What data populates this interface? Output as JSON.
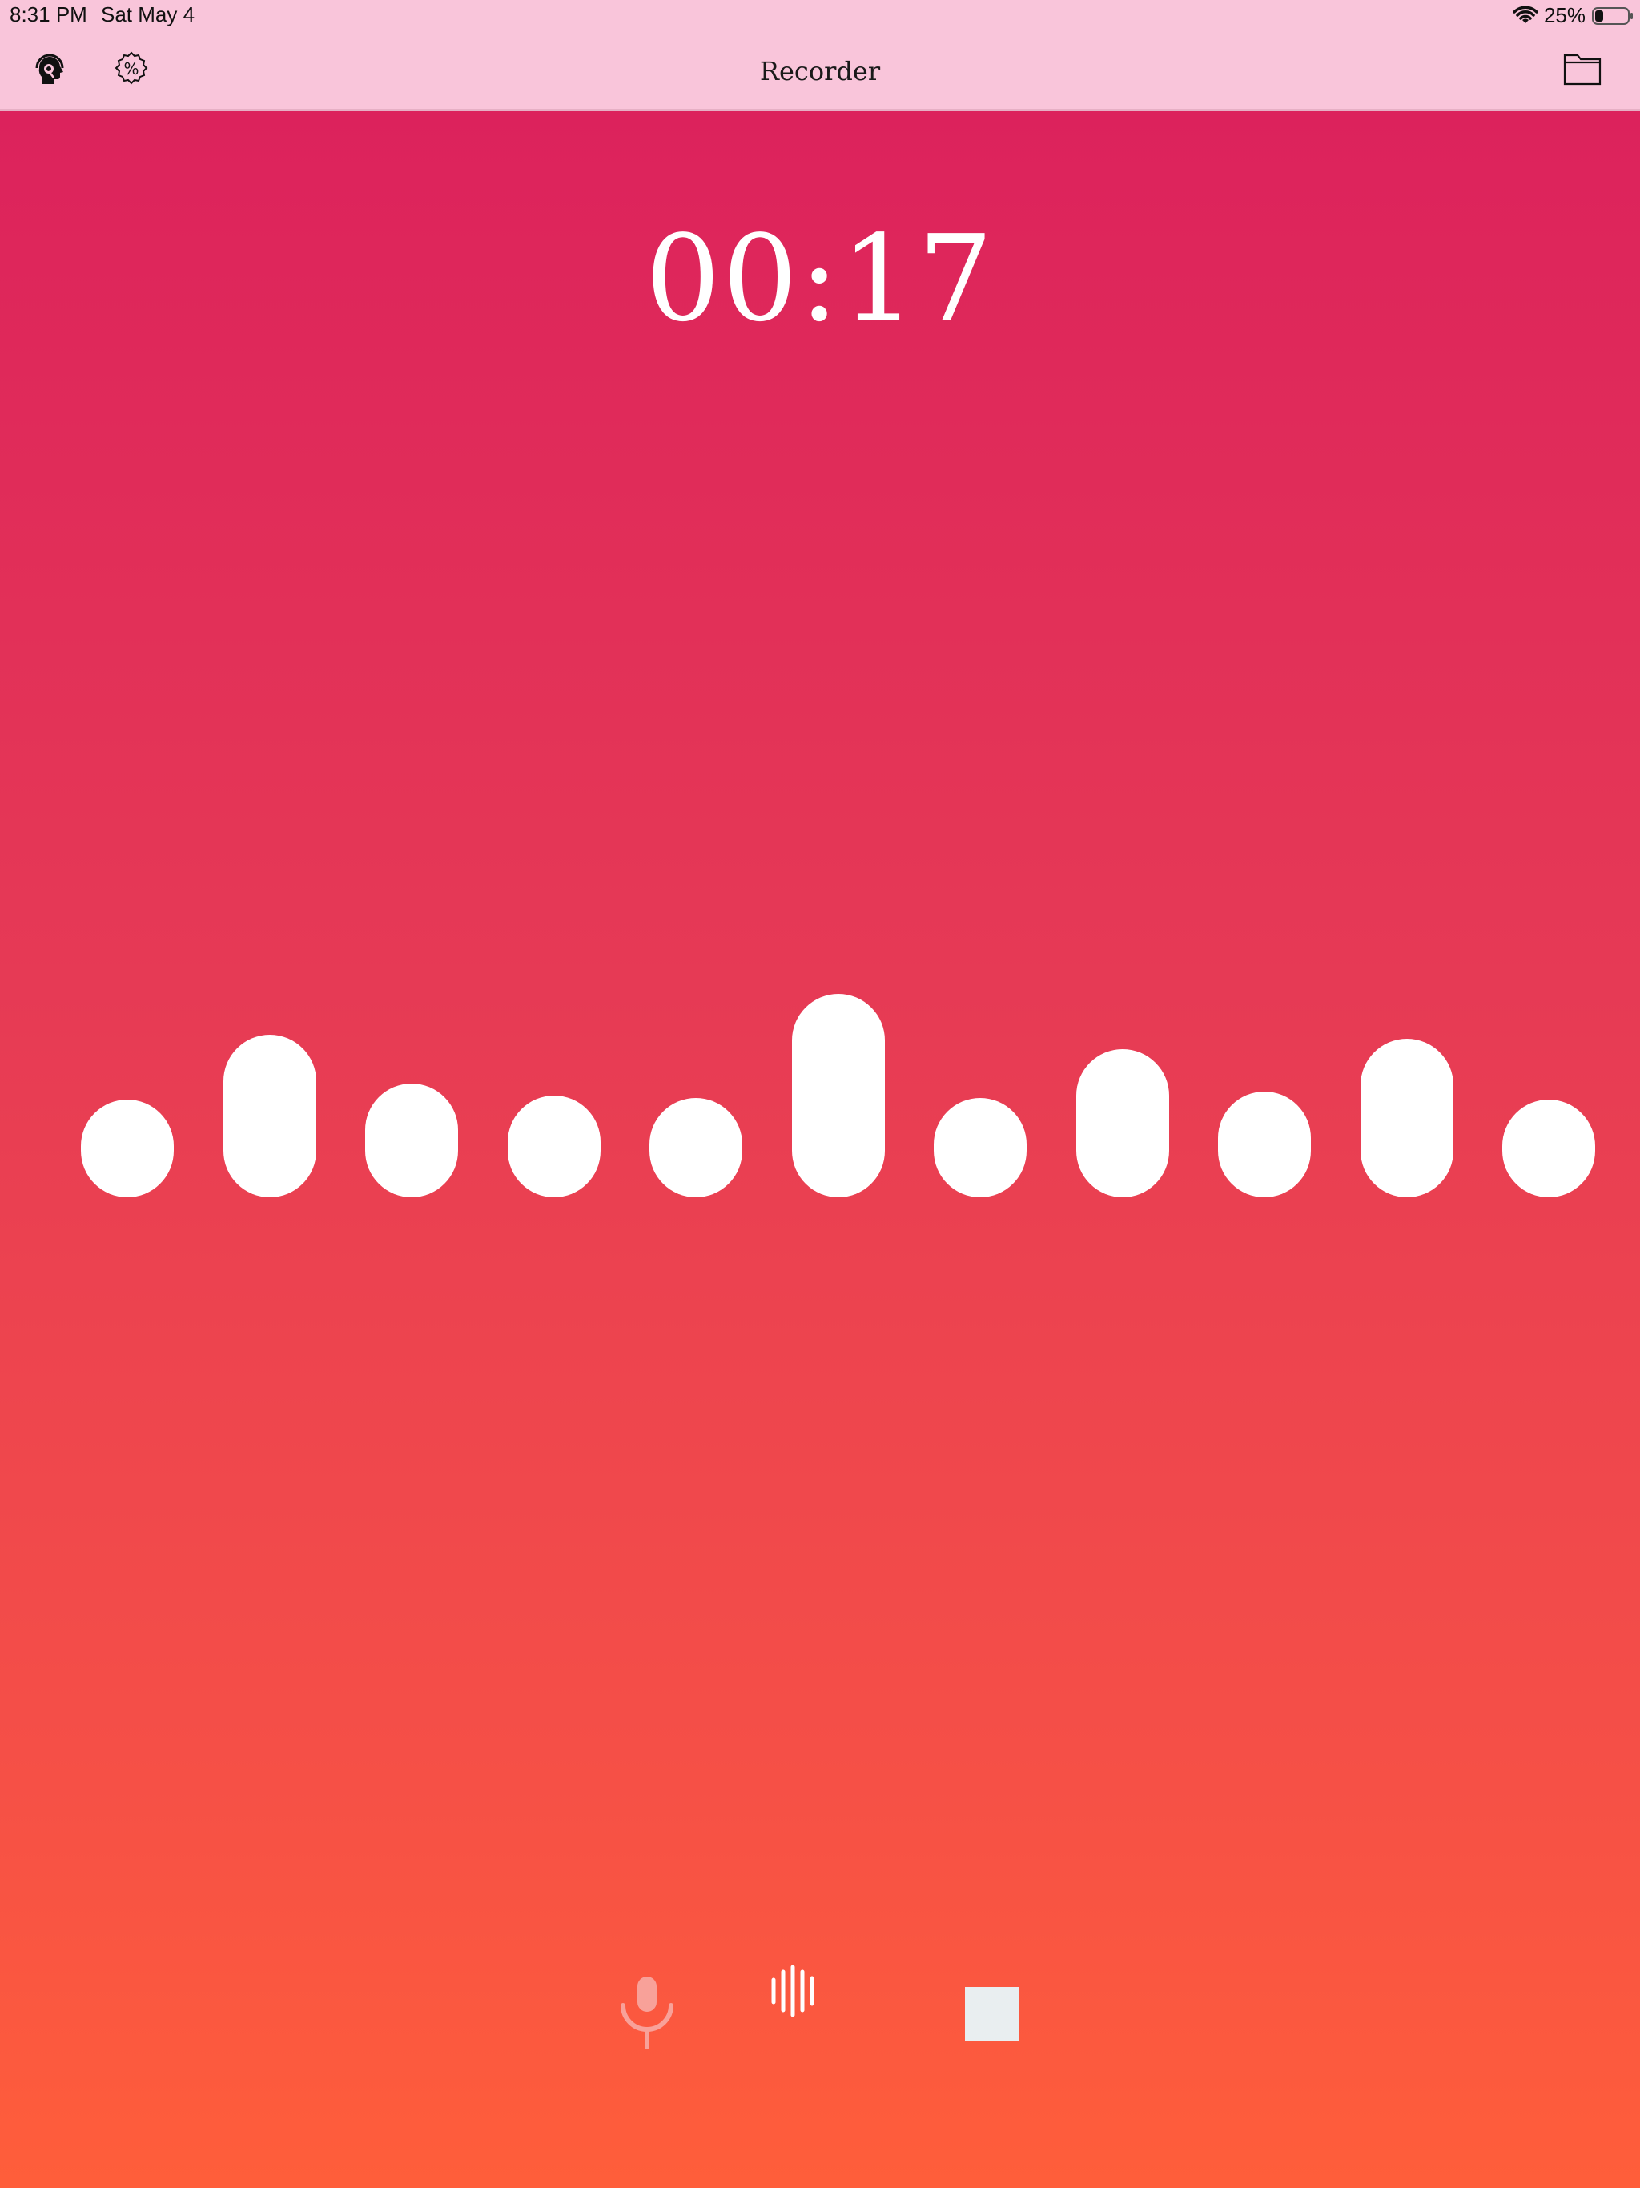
{
  "status_bar": {
    "time": "8:31 PM",
    "date": "Sat May 4",
    "battery_percent": "25%",
    "battery_level": 0.25
  },
  "nav": {
    "title": "Recorder",
    "left_icons": [
      "support-agent-icon",
      "settings-badge-icon"
    ],
    "right_icon": "folder-icon"
  },
  "recorder": {
    "elapsed": "00:17",
    "levels": [
      0.48,
      0.8,
      0.56,
      0.5,
      0.49,
      1.0,
      0.49,
      0.73,
      0.52,
      0.78,
      0.48
    ]
  },
  "controls": {
    "icons": [
      "microphone-icon",
      "waveform-icon",
      "stop-icon"
    ]
  },
  "colors": {
    "nav_background": "#f9c5da",
    "gradient_top": "#db1f5d",
    "gradient_bottom": "#ff5e3a",
    "foreground": "#ffffff"
  }
}
